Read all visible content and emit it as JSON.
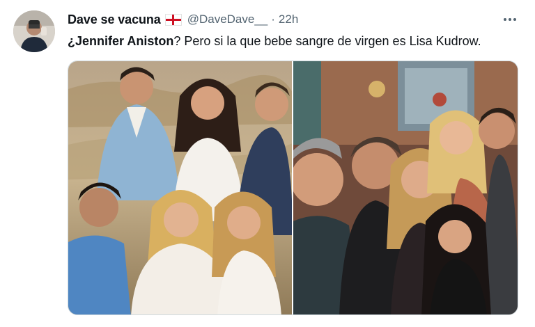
{
  "tweet": {
    "display_name": "Dave se vacuna",
    "flag_icon": "england-flag-icon",
    "handle": "@DaveDave__",
    "separator": "·",
    "time": "22h",
    "text_bold": "¿Jennifer Aniston",
    "text_rest": "? Pero si la que bebe sangre de virgen es Lisa Kudrow.",
    "more_icon": "more-horizontal-icon"
  },
  "media": {
    "left_photo": "group-photo-outdoor",
    "right_photo": "group-selfie-indoor"
  }
}
